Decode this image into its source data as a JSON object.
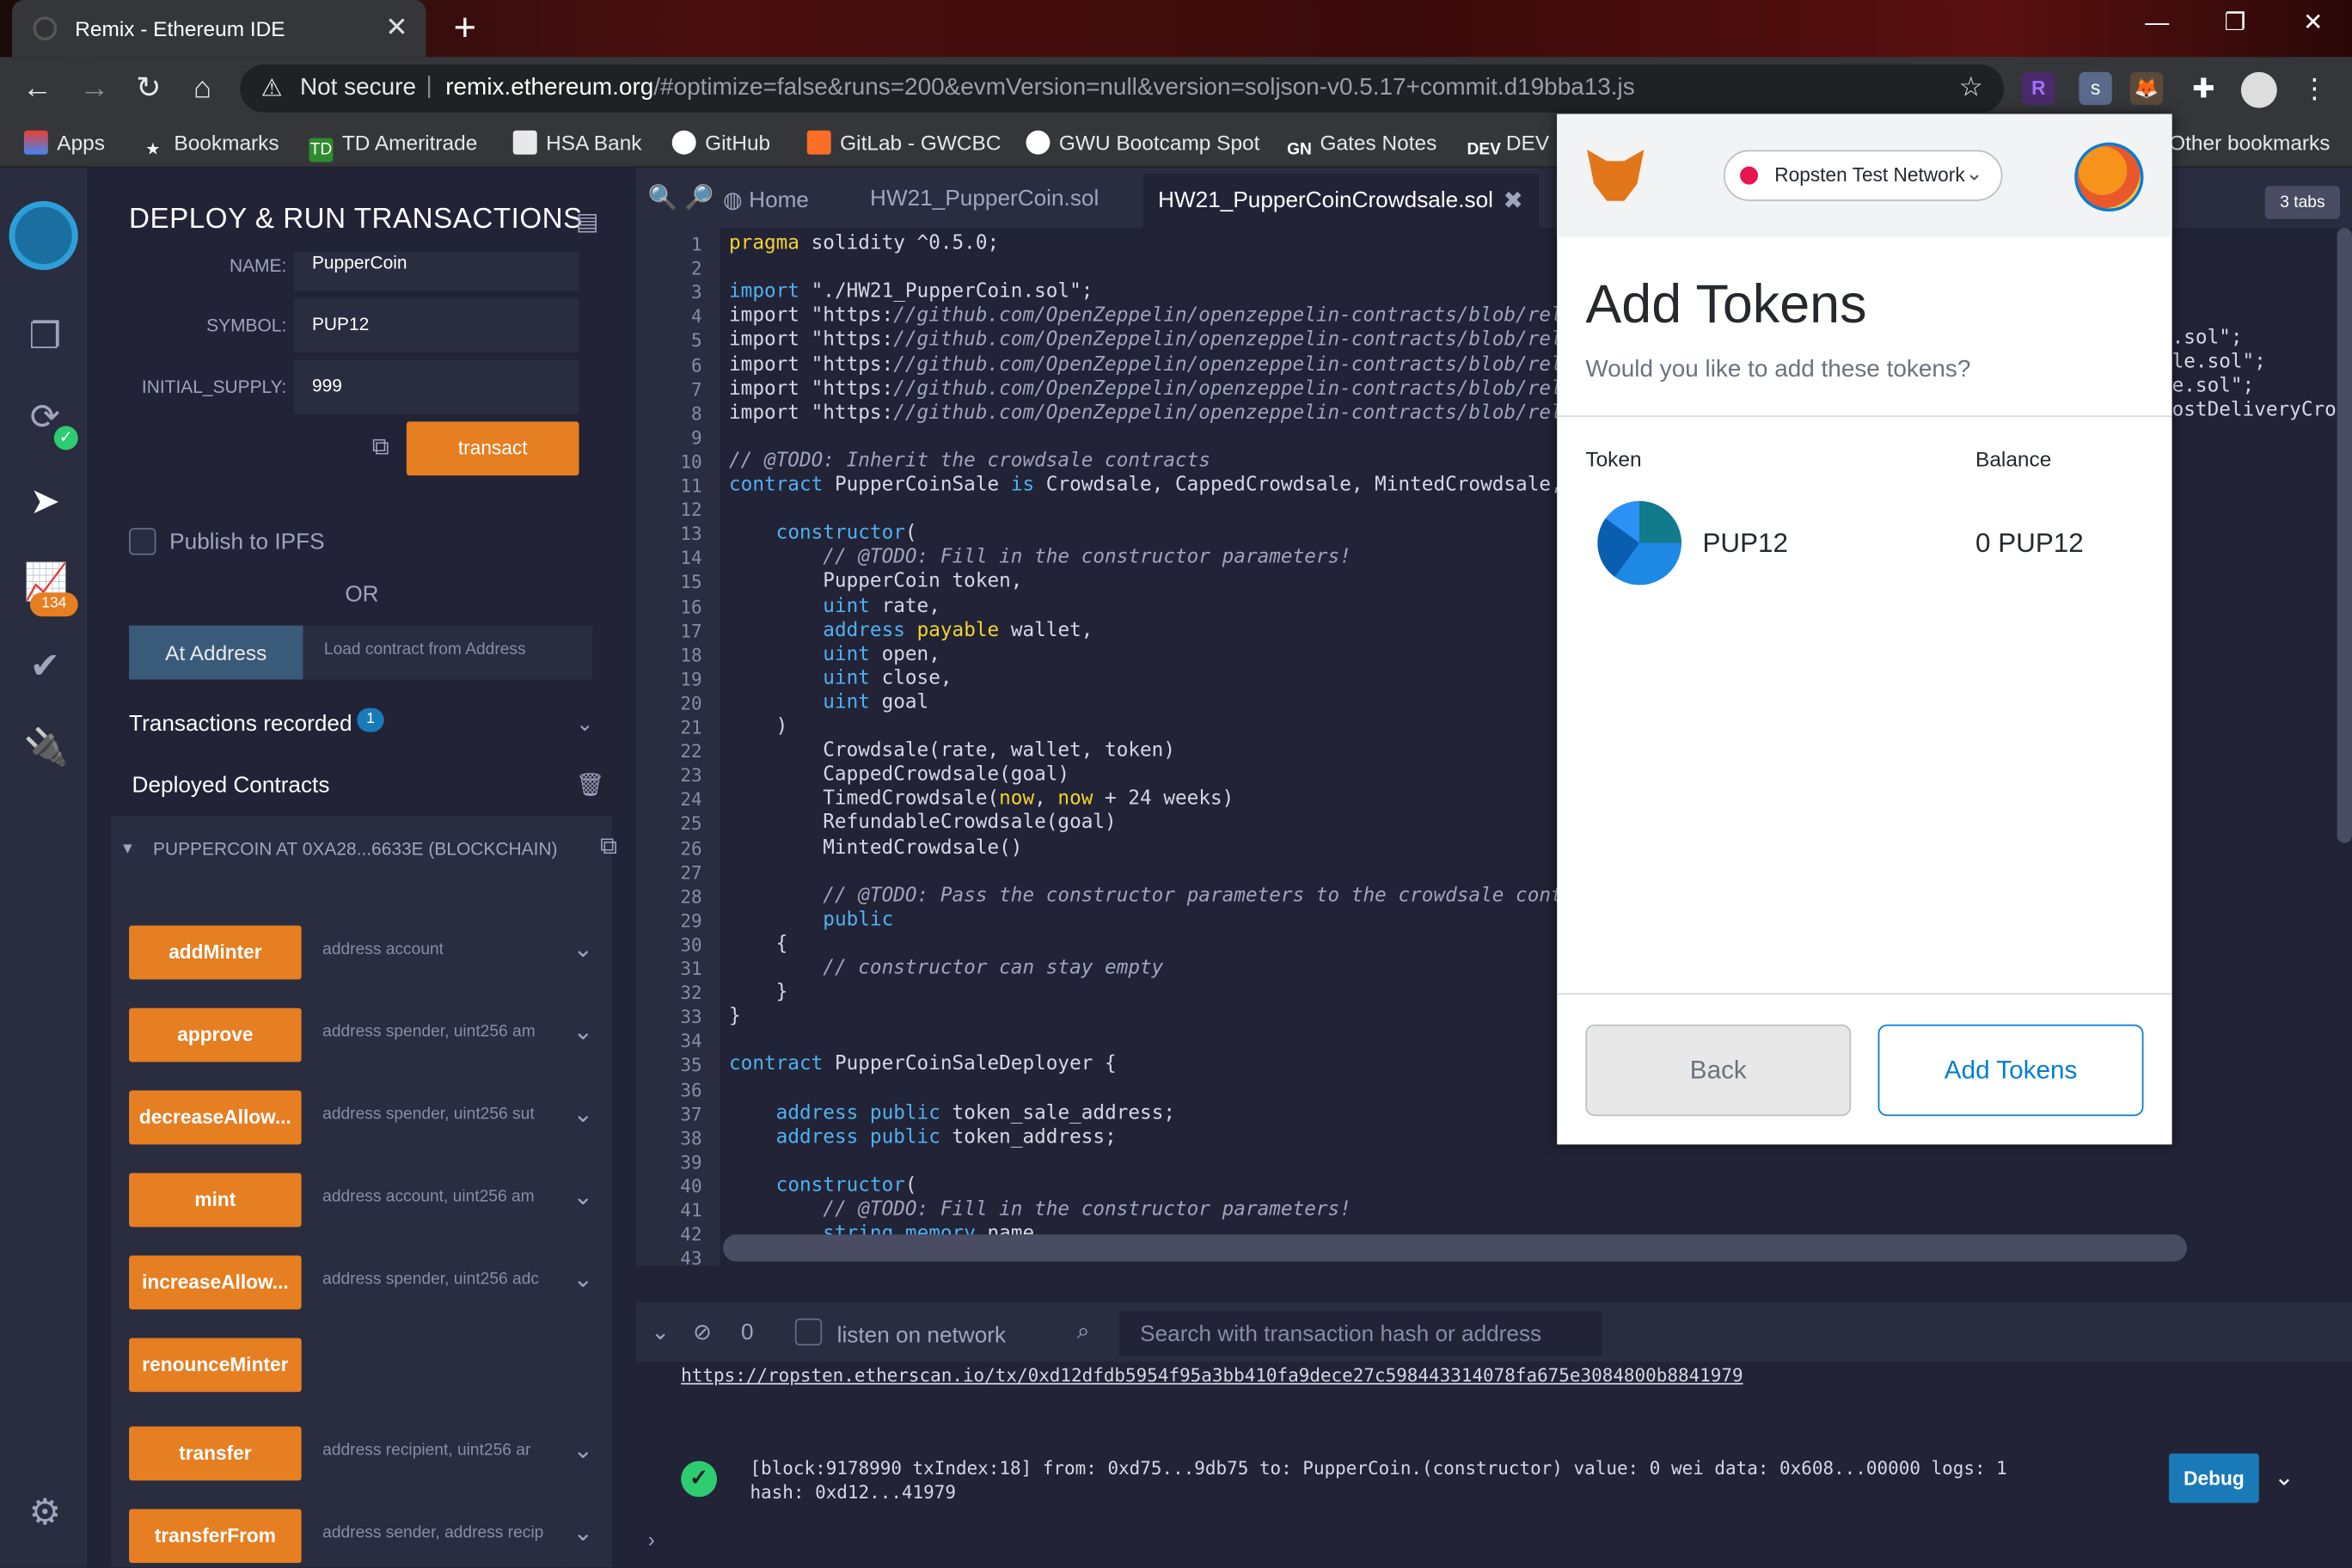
{
  "browser": {
    "tab_title": "Remix - Ethereum IDE",
    "not_secure": "Not secure",
    "url_host": "remix.ethereum.org",
    "url_rest": "/#optimize=false&runs=200&evmVersion=null&version=soljson-v0.5.17+commit.d19bba13.js",
    "bookmarks": [
      "Apps",
      "Bookmarks",
      "TD Ameritrade",
      "HSA Bank",
      "GitHub",
      "GitLab - GWCBC",
      "GWU Bootcamp Spot",
      "Gates Notes",
      "DEV"
    ],
    "other_bookmarks": "Other bookmarks"
  },
  "remix": {
    "panel_title": "DEPLOY & RUN TRANSACTIONS",
    "name_label": "NAME:",
    "name_value": "PupperCoin",
    "symbol_label": "SYMBOL:",
    "symbol_value": "PUP12",
    "supply_label": "INITIAL_SUPPLY:",
    "supply_value": "999",
    "transact": "transact",
    "publish_ipfs": "Publish to IPFS",
    "or": "OR",
    "at_address": "At Address",
    "load_placeholder": "Load contract from Address",
    "transactions_recorded": "Transactions recorded",
    "tx_count": "1",
    "deployed_contracts": "Deployed Contracts",
    "contract_instance": "PUPPERCOIN AT 0XA28...6633E (BLOCKCHAIN)",
    "badge_134": "134",
    "functions": [
      {
        "name": "addMinter",
        "placeholder": "address account"
      },
      {
        "name": "approve",
        "placeholder": "address spender, uint256 am"
      },
      {
        "name": "decreaseAllow...",
        "placeholder": "address spender, uint256 sut"
      },
      {
        "name": "mint",
        "placeholder": "address account, uint256 am"
      },
      {
        "name": "increaseAllow...",
        "placeholder": "address spender, uint256 adc"
      },
      {
        "name": "renounceMinter",
        "placeholder": ""
      },
      {
        "name": "transfer",
        "placeholder": "address recipient, uint256 ar"
      },
      {
        "name": "transferFrom",
        "placeholder": "address sender, address recip"
      }
    ],
    "editor_tabs": [
      "Home",
      "HW21_PupperCoin.sol",
      "HW21_PupperCoinCrowdsale.sol"
    ],
    "tabs_count": "3 tabs",
    "right_fragments": [
      ".sol\";",
      "le.sol\";",
      "e.sol\";",
      "ostDeliveryCro"
    ],
    "terminal": {
      "count": "0",
      "listen": "listen on network",
      "search_placeholder": "Search with transaction hash or address",
      "link": "https://ropsten.etherscan.io/tx/0xd12dfdb5954f95a3bb410fa9dece27c598443314078fa675e3084800b8841979",
      "log_line1": "[block:9178990 txIndex:18] from: 0xd75...9db75 to: PupperCoin.(constructor) value: 0 wei data: 0x608...00000 logs: 1",
      "log_line2": "hash: 0xd12...41979",
      "debug": "Debug"
    }
  },
  "code_lines": [
    "pragma solidity ^0.5.0;",
    "",
    "import \"./HW21_PupperCoin.sol\";",
    "import \"https://github.com/OpenZeppelin/openzeppelin-contracts/blob/relea",
    "import \"https://github.com/OpenZeppelin/openzeppelin-contracts/blob/relea",
    "import \"https://github.com/OpenZeppelin/openzeppelin-contracts/blob/relea",
    "import \"https://github.com/OpenZeppelin/openzeppelin-contracts/blob/relea",
    "import \"https://github.com/OpenZeppelin/openzeppelin-contracts/blob/relea",
    "",
    "// @TODO: Inherit the crowdsale contracts",
    "contract PupperCoinSale is Crowdsale, CappedCrowdsale, MintedCrowdsale, T",
    "",
    "    constructor(",
    "        // @TODO: Fill in the constructor parameters!",
    "        PupperCoin token,",
    "        uint rate,",
    "        address payable wallet,",
    "        uint open,",
    "        uint close,",
    "        uint goal",
    "    )",
    "        Crowdsale(rate, wallet, token)",
    "        CappedCrowdsale(goal)",
    "        TimedCrowdsale(now, now + 24 weeks)",
    "        RefundableCrowdsale(goal)",
    "        MintedCrowdsale()",
    "",
    "        // @TODO: Pass the constructor parameters to the crowdsale contra",
    "        public",
    "    {",
    "        // constructor can stay empty",
    "    }",
    "}",
    "",
    "contract PupperCoinSaleDeployer {",
    "",
    "    address public token_sale_address;",
    "    address public token_address;",
    "",
    "    constructor(",
    "        // @TODO: Fill in the constructor parameters!",
    "        string memory name,",
    ""
  ],
  "metamask": {
    "network": "Ropsten Test Network",
    "title": "Add Tokens",
    "subtitle": "Would you like to add these tokens?",
    "col_token": "Token",
    "col_balance": "Balance",
    "token_symbol": "PUP12",
    "token_balance": "0 PUP12",
    "back": "Back",
    "add": "Add Tokens",
    "accent_color": "#037dd6"
  }
}
